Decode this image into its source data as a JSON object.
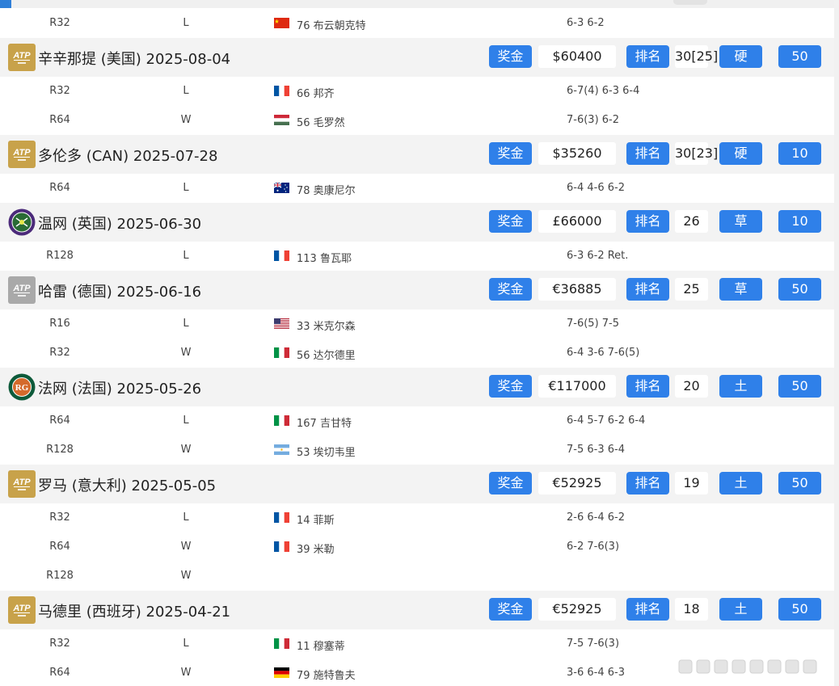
{
  "colors": {
    "accent": "#2f80e9",
    "tournament_row_bg": "#f3f3f3"
  },
  "top_match": {
    "round": "R32",
    "result": "L",
    "flag": "china-flag-icon",
    "opponent": "76 布云朝克特",
    "score": "6-3 6-2"
  },
  "tournaments": [
    {
      "logo": "atp-1000-logo-icon",
      "title": "辛辛那提 (美国) 2025-08-04",
      "prize_label": "奖金",
      "prize": "$60400",
      "rank_label": "排名",
      "rank": "30[25]",
      "surface": "硬",
      "points": "50",
      "matches": [
        {
          "round": "R32",
          "result": "L",
          "flag": "france-flag-icon",
          "opponent": "66 邦齐",
          "score": "6-7(4) 6-3 6-4"
        },
        {
          "round": "R64",
          "result": "W",
          "flag": "hungary-flag-icon",
          "opponent": "56 毛罗然",
          "score": "7-6(3) 6-2"
        }
      ]
    },
    {
      "logo": "atp-1000-logo-icon",
      "title": "多伦多 (CAN) 2025-07-28",
      "prize_label": "奖金",
      "prize": "$35260",
      "rank_label": "排名",
      "rank": "30[23]",
      "surface": "硬",
      "points": "10",
      "matches": [
        {
          "round": "R64",
          "result": "L",
          "flag": "australia-flag-icon",
          "opponent": "78 奥康尼尔",
          "score": "6-4 4-6 6-2"
        }
      ]
    },
    {
      "logo": "wimbledon-logo-icon",
      "title": "温网 (英国) 2025-06-30",
      "prize_label": "奖金",
      "prize": "£66000",
      "rank_label": "排名",
      "rank": "26",
      "surface": "草",
      "points": "10",
      "matches": [
        {
          "round": "R128",
          "result": "L",
          "flag": "france-flag-icon",
          "opponent": "113 鲁瓦耶",
          "score": "6-3 6-2 Ret."
        }
      ]
    },
    {
      "logo": "atp-500-logo-icon",
      "title": "哈雷 (德国) 2025-06-16",
      "prize_label": "奖金",
      "prize": "€36885",
      "rank_label": "排名",
      "rank": "25",
      "surface": "草",
      "points": "50",
      "matches": [
        {
          "round": "R16",
          "result": "L",
          "flag": "usa-flag-icon",
          "opponent": "33 米克尔森",
          "score": "7-6(5) 7-5"
        },
        {
          "round": "R32",
          "result": "W",
          "flag": "italy-flag-icon",
          "opponent": "56 达尔德里",
          "score": "6-4 3-6 7-6(5)"
        }
      ]
    },
    {
      "logo": "roland-garros-logo-icon",
      "title": "法网 (法国) 2025-05-26",
      "prize_label": "奖金",
      "prize": "€117000",
      "rank_label": "排名",
      "rank": "20",
      "surface": "土",
      "points": "50",
      "matches": [
        {
          "round": "R64",
          "result": "L",
          "flag": "italy-flag-icon",
          "opponent": "167 吉甘特",
          "score": "6-4 5-7 6-2 6-4"
        },
        {
          "round": "R128",
          "result": "W",
          "flag": "argentina-flag-icon",
          "opponent": "53 埃切韦里",
          "score": "7-5 6-3 6-4"
        }
      ]
    },
    {
      "logo": "atp-1000-logo-icon",
      "title": "罗马 (意大利) 2025-05-05",
      "prize_label": "奖金",
      "prize": "€52925",
      "rank_label": "排名",
      "rank": "19",
      "surface": "土",
      "points": "50",
      "matches": [
        {
          "round": "R32",
          "result": "L",
          "flag": "france-flag-icon",
          "opponent": "14 菲斯",
          "score": "2-6 6-4 6-2"
        },
        {
          "round": "R64",
          "result": "W",
          "flag": "france-flag-icon",
          "opponent": "39 米勒",
          "score": "6-2 7-6(3)"
        },
        {
          "round": "R128",
          "result": "W",
          "flag": "",
          "opponent": "",
          "score": ""
        }
      ]
    },
    {
      "logo": "atp-1000-logo-icon",
      "title": "马德里 (西班牙) 2025-04-21",
      "prize_label": "奖金",
      "prize": "€52925",
      "rank_label": "排名",
      "rank": "18",
      "surface": "土",
      "points": "50",
      "matches": [
        {
          "round": "R32",
          "result": "L",
          "flag": "italy-flag-icon",
          "opponent": "11 穆塞蒂",
          "score": "7-5 7-6(3)"
        },
        {
          "round": "R64",
          "result": "W",
          "flag": "germany-flag-icon",
          "opponent": "79 施特鲁夫",
          "score": "3-6 6-4 6-3"
        }
      ]
    }
  ]
}
